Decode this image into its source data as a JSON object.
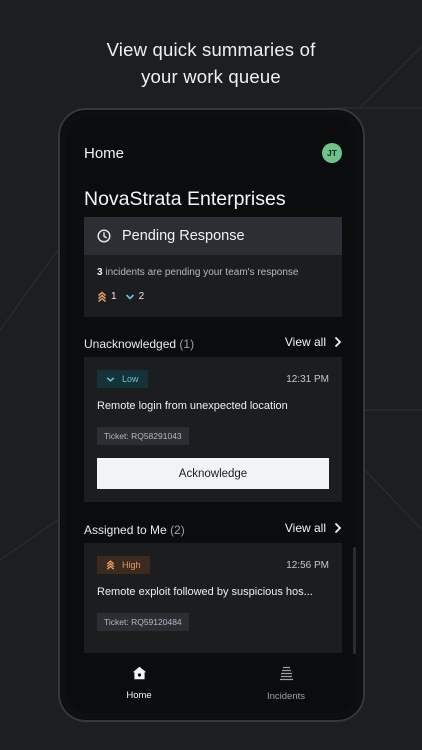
{
  "headline": {
    "line1": "View quick summaries of",
    "line2": "your work queue"
  },
  "app": {
    "title": "Home",
    "avatar_initials": "JT",
    "org_name": "NovaStrata Enterprises"
  },
  "pending": {
    "title": "Pending Response",
    "icon": "clock-icon",
    "count": "3",
    "text": " incidents are pending your team's response",
    "high_count": "1",
    "low_count": "2"
  },
  "unacknowledged": {
    "label": "Unacknowledged",
    "count": "(1)",
    "view_all": "View all",
    "incident": {
      "severity": "Low",
      "time": "12:31 PM",
      "title": "Remote login from unexpected location",
      "ticket": "Ticket: RQ58291043",
      "action": "Acknowledge"
    }
  },
  "assigned": {
    "label": "Assigned to Me",
    "count": "(2)",
    "view_all": "View all",
    "incident": {
      "severity": "High",
      "time": "12:56 PM",
      "title": "Remote exploit followed by suspicious hos...",
      "ticket": "Ticket: RQ59120484"
    }
  },
  "nav": {
    "home": "Home",
    "incidents": "Incidents"
  },
  "colors": {
    "background": "#1c1f22",
    "card": "#1b1d1f",
    "low": "#5fc9d6",
    "high": "#e69a5e",
    "avatar": "#6fc28a"
  }
}
